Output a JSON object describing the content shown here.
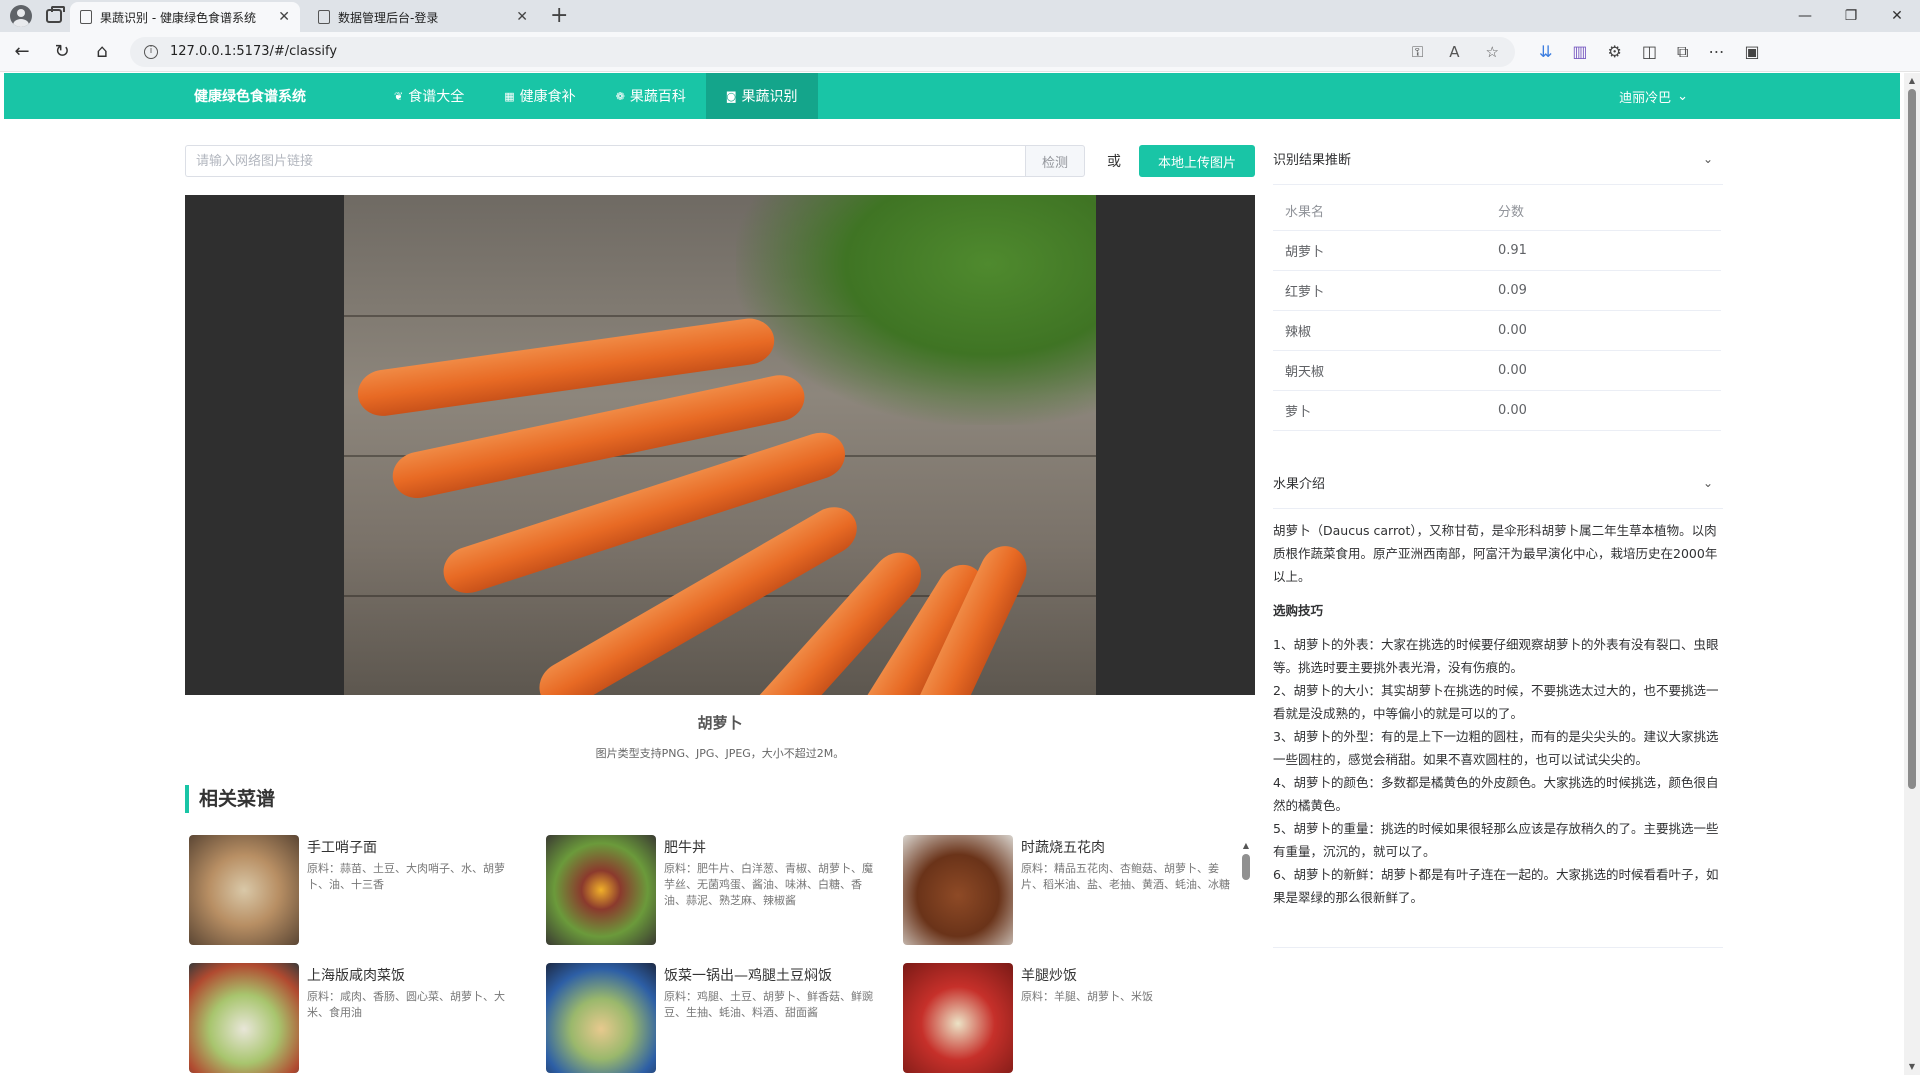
{
  "browser": {
    "tabs": [
      {
        "title": "果蔬识别 - 健康绿色食谱系统",
        "active": true
      },
      {
        "title": "数据管理后台-登录",
        "active": false
      }
    ],
    "url": "127.0.0.1:5173/#/classify"
  },
  "nav": {
    "brand": "健康绿色食谱系统",
    "items": [
      {
        "label": "食谱大全",
        "icon": "leaf-icon"
      },
      {
        "label": "健康食补",
        "icon": "grid-icon"
      },
      {
        "label": "果蔬百科",
        "icon": "apple-icon"
      },
      {
        "label": "果蔬识别",
        "icon": "camera-icon",
        "active": true
      }
    ],
    "user": "迪丽冷巴"
  },
  "search": {
    "placeholder": "请输入网络图片链接",
    "detect_label": "检测",
    "or_label": "或",
    "upload_label": "本地上传图片"
  },
  "image": {
    "caption": "胡萝卜",
    "hint": "图片类型支持PNG、JPG、JPEG，大小不超过2M。"
  },
  "recipes": {
    "title": "相关菜谱",
    "items": [
      {
        "name": "手工哨子面",
        "ingredients": "原料：蒜苗、土豆、大肉哨子、水、胡萝卜、油、十三香"
      },
      {
        "name": "肥牛丼",
        "ingredients": "原料：肥牛片、白洋葱、青椒、胡萝卜、魔芋丝、无菌鸡蛋、酱油、味淋、白糖、香油、蒜泥、熟芝麻、辣椒酱"
      },
      {
        "name": "时蔬烧五花肉",
        "ingredients": "原料：精品五花肉、杏鲍菇、胡萝卜、姜片、稻米油、盐、老抽、黄酒、蚝油、冰糖"
      },
      {
        "name": "上海版咸肉菜饭",
        "ingredients": "原料：咸肉、香肠、圆心菜、胡萝卜、大米、食用油"
      },
      {
        "name": "饭菜一锅出—鸡腿土豆焖饭",
        "ingredients": "原料：鸡腿、土豆、胡萝卜、鲜香菇、鲜豌豆、生抽、蚝油、料酒、甜面酱"
      },
      {
        "name": "羊腿炒饭",
        "ingredients": "原料：羊腿、胡萝卜、米饭"
      }
    ]
  },
  "results": {
    "title": "识别结果推断",
    "columns": [
      "水果名",
      "分数"
    ],
    "rows": [
      {
        "name": "胡萝卜",
        "score": "0.91"
      },
      {
        "name": "红萝卜",
        "score": "0.09"
      },
      {
        "name": "辣椒",
        "score": "0.00"
      },
      {
        "name": "朝天椒",
        "score": "0.00"
      },
      {
        "name": "萝卜",
        "score": "0.00"
      }
    ]
  },
  "intro": {
    "title": "水果介绍",
    "description": "胡萝卜（Daucus carrot），又称甘荀，是伞形科胡萝卜属二年生草本植物。以肉质根作蔬菜食用。原产亚洲西南部，阿富汗为最早演化中心，栽培历史在2000年以上。",
    "tips_title": "选购技巧",
    "tips": [
      "1、胡萝卜的外表：大家在挑选的时候要仔细观察胡萝卜的外表有没有裂口、虫眼等。挑选时要主要挑外表光滑，没有伤痕的。",
      "2、胡萝卜的大小：其实胡萝卜在挑选的时候，不要挑选太过大的，也不要挑选一看就是没成熟的，中等偏小的就是可以的了。",
      "3、胡萝卜的外型：有的是上下一边粗的圆柱，而有的是尖尖头的。建议大家挑选一些圆柱的，感觉会稍甜。如果不喜欢圆柱的，也可以试试尖尖的。",
      "4、胡萝卜的颜色：多数都是橘黄色的外皮颜色。大家挑选的时候挑选，颜色很自然的橘黄色。",
      "5、胡萝卜的重量：挑选的时候如果很轻那么应该是存放稍久的了。主要挑选一些有重量，沉沉的，就可以了。",
      "6、胡萝卜的新鲜：胡萝卜都是有叶子连在一起的。大家挑选的时候看看叶子，如果是翠绿的那么很新鲜了。"
    ]
  },
  "colors": {
    "accent": "#19c5a6",
    "accent_dark": "#14a58b"
  }
}
